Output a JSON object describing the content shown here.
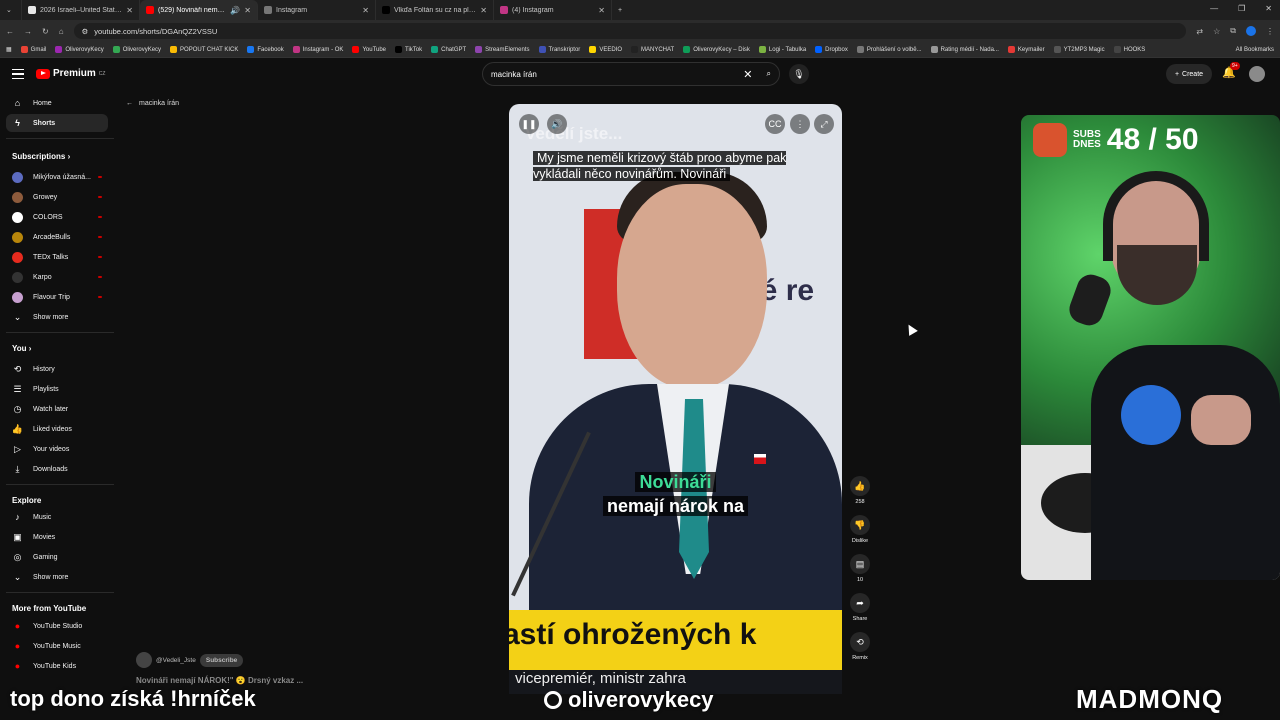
{
  "browser": {
    "tabs": [
      {
        "title": "2026 Israeli–United States strik",
        "color": "#e8e8e8"
      },
      {
        "title": "(529) Novináři nemají NÁR",
        "color": "#ff0000",
        "active": true
      },
      {
        "title": "Instagram",
        "color": "#c13584"
      },
      {
        "title": "Vlkďa Foltán su cz na platformě",
        "color": "#000000"
      },
      {
        "title": "(4) Instagram",
        "color": "#c13584"
      }
    ],
    "url": "youtube.com/shorts/DGAnQZ2VSSU",
    "bookmarks": [
      "Gmail",
      "OliverovyKecy",
      "OliverovyKecy",
      "POPOUT CHAT KICK",
      "Facebook",
      "Instagram - OK",
      "YouTube",
      "TikTok",
      "ChatGPT",
      "StreamElements",
      "Transkriptor",
      "VEEDIO",
      "MANYCHAT",
      "OliverovyKecy – Disk",
      "Logi - Tabulka",
      "Dropbox",
      "Prohlášení o volbě...",
      "Rating médií - Nada...",
      "Keymailer",
      "YT2MP3 Magic",
      "HOOKS"
    ],
    "all_bookmarks": "All Bookmarks"
  },
  "header": {
    "logo": "Premium",
    "logo_sup": "CZ",
    "search_value": "macinka írán",
    "create": "Create",
    "notif_badge": "9+"
  },
  "sidebar": {
    "home": "Home",
    "shorts": "Shorts",
    "subscriptions_title": "Subscriptions",
    "subscriptions": [
      {
        "name": "Mikýfova úžasná...",
        "color": "#5c6bc0"
      },
      {
        "name": "Growey",
        "color": "#8d5b3c"
      },
      {
        "name": "COLORS",
        "color": "#ffffff"
      },
      {
        "name": "ArcadeBulls",
        "color": "#b8860b"
      },
      {
        "name": "TEDx Talks",
        "color": "#e62b1e"
      },
      {
        "name": "Karpo",
        "color": "#333333"
      },
      {
        "name": "Flavour Trip",
        "color": "#c7a0d0"
      }
    ],
    "show_more": "Show more",
    "you_title": "You",
    "you": [
      "History",
      "Playlists",
      "Watch later",
      "Liked videos",
      "Your videos",
      "Downloads"
    ],
    "explore_title": "Explore",
    "explore": [
      "Music",
      "Movies",
      "Gaming"
    ],
    "explore_more": "Show more",
    "more_title": "More from YouTube",
    "more": [
      "YouTube Studio",
      "YouTube Music",
      "YouTube Kids"
    ]
  },
  "back_label": "macinka írán",
  "video": {
    "watermark": "Vedělí jste...",
    "caption_top": "My jsme neměli krizový štáb proo abyme pak vykládali něco novinářům. Novináři",
    "caption_mid_1": "Novináři",
    "caption_mid_2": "nemají nárok na",
    "lower_third": "astí ohrožených k",
    "lower_sub": "vicepremiér, ministr zahra",
    "wall_text": "a\nké re"
  },
  "actions": {
    "likes": "258",
    "dislike": "Dislike",
    "comments": "10",
    "share": "Share",
    "remix": "Remix"
  },
  "channel": {
    "handle": "@Vedeli_Jste",
    "subscribe": "Subscribe",
    "title": "Novináři nemají NÁROK!\" 😮 Drsný vzkaz ..."
  },
  "overlay": {
    "subs_label_1": "SUBS",
    "subs_label_2": "DNES",
    "subs_count": "48 / 50",
    "left": "top dono získá !hrníček",
    "mid": "oliverovykecy",
    "right": "MADMONQ"
  }
}
